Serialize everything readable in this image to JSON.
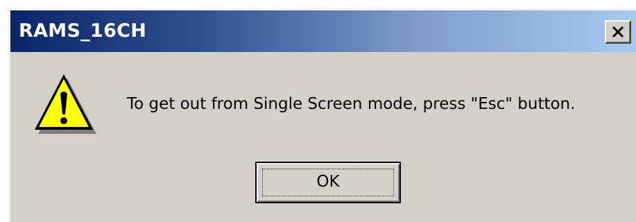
{
  "window": {
    "title": "RAMS_16CH",
    "close_icon": "close-icon",
    "titlebar_colors": [
      "#0a246a",
      "#a6caf0"
    ]
  },
  "dialog": {
    "icon": "warning-icon",
    "message": "To get out from Single Screen mode, press \"Esc\" button.",
    "ok_label": "OK",
    "background_color": "#d4d0c8"
  }
}
